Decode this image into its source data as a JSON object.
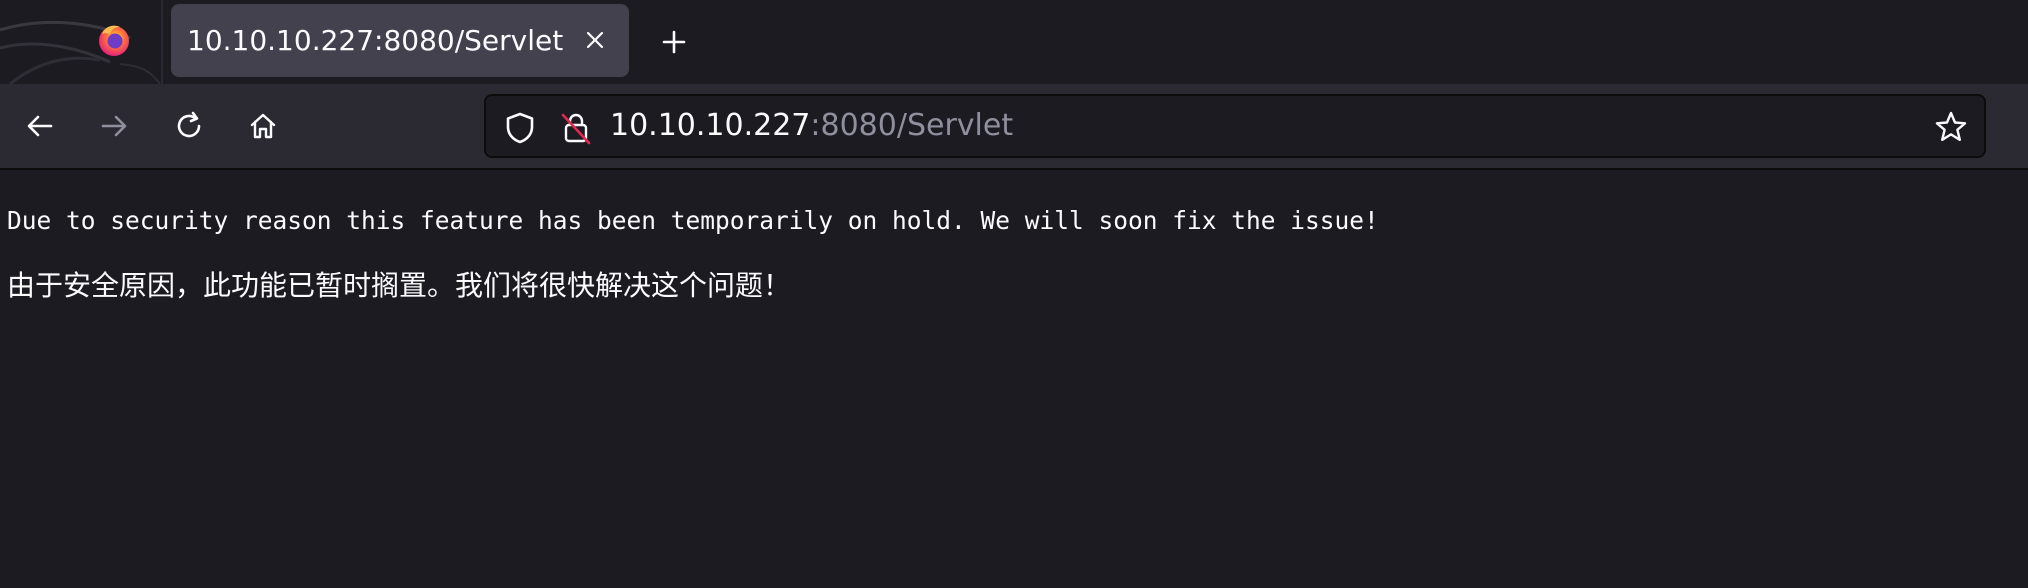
{
  "browser": {
    "tab": {
      "title": "10.10.10.227:8080/Servlet",
      "close_icon": "close-icon"
    },
    "new_tab_icon": "plus-icon",
    "app_icon": "firefox-icon",
    "nav": {
      "back_icon": "arrow-left-icon",
      "forward_icon": "arrow-right-icon",
      "reload_icon": "reload-icon",
      "home_icon": "home-icon"
    },
    "urlbar": {
      "host": "10.10.10.227",
      "rest": ":8080/Servlet",
      "shield_icon": "shield-icon",
      "insecure_icon": "insecure-lock-icon",
      "bookmark_icon": "star-icon"
    }
  },
  "page": {
    "message_en": "Due to security reason this feature has been temporarily on hold. We will soon fix the issue!",
    "message_zh": "由于安全原因，此功能已暂时搁置。我们将很快解决这个问题！"
  },
  "colors": {
    "background": "#1c1b22",
    "toolbar": "#2b2a33",
    "tab_active": "#42414d",
    "text": "#fbfbfe",
    "text_dim": "#8f8f9d"
  }
}
